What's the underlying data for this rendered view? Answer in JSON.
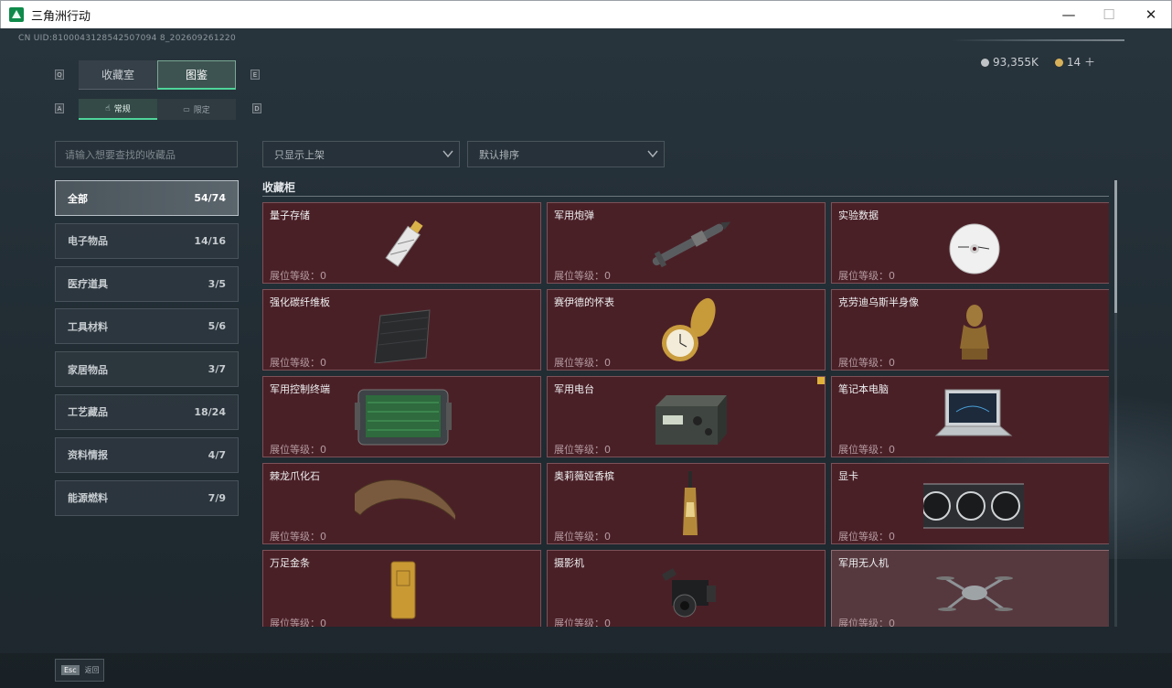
{
  "window": {
    "title": "三角洲行动",
    "controls": {
      "minimize": "—",
      "maximize": "☐",
      "close": "✕"
    }
  },
  "header": {
    "uid": "CN UID:8100043128542507094 8_202609261220",
    "currency": [
      {
        "icon": "silver-coin-icon",
        "value": "93,355K",
        "color": "#c0c4c7"
      },
      {
        "icon": "gold-coin-icon",
        "value": "14 ＋",
        "color": "#d8b15a"
      }
    ]
  },
  "keys": {
    "q": "Q",
    "e": "E",
    "a": "A",
    "d": "D"
  },
  "main_tabs": [
    {
      "label": "收藏室",
      "active": false
    },
    {
      "label": "图鉴",
      "active": true
    }
  ],
  "sub_tabs": [
    {
      "label": "常规",
      "icon": "hand-icon",
      "active": true
    },
    {
      "label": "限定",
      "icon": "card-icon",
      "active": false
    }
  ],
  "search": {
    "placeholder": "请输入想要查找的收藏品"
  },
  "filters": {
    "shelf": "只显示上架",
    "sort": "默认排序"
  },
  "categories": [
    {
      "label": "全部",
      "count": "54/74",
      "active": true
    },
    {
      "label": "电子物品",
      "count": "14/16"
    },
    {
      "label": "医疗道具",
      "count": "3/5"
    },
    {
      "label": "工具材料",
      "count": "5/6"
    },
    {
      "label": "家居物品",
      "count": "3/7"
    },
    {
      "label": "工艺藏品",
      "count": "18/24"
    },
    {
      "label": "资料情报",
      "count": "4/7"
    },
    {
      "label": "能源燃料",
      "count": "7/9"
    }
  ],
  "section_title": "收藏柜",
  "items": [
    {
      "name": "量子存储",
      "level": "展位等级：0",
      "icon": "usb-drive-icon"
    },
    {
      "name": "军用炮弹",
      "level": "展位等级：0",
      "icon": "missile-icon"
    },
    {
      "name": "实验数据",
      "level": "展位等级：0",
      "icon": "disc-icon"
    },
    {
      "name": "强化碳纤维板",
      "level": "展位等级：0",
      "icon": "carbon-plate-icon"
    },
    {
      "name": "赛伊德的怀表",
      "level": "展位等级：0",
      "icon": "pocket-watch-icon"
    },
    {
      "name": "克劳迪乌斯半身像",
      "level": "展位等级：0",
      "icon": "bust-icon"
    },
    {
      "name": "军用控制终端",
      "level": "展位等级：0",
      "icon": "tablet-terminal-icon"
    },
    {
      "name": "军用电台",
      "level": "展位等级：0",
      "icon": "radio-icon",
      "badge": true
    },
    {
      "name": "笔记本电脑",
      "level": "展位等级：0",
      "icon": "laptop-icon"
    },
    {
      "name": "棘龙爪化石",
      "level": "展位等级：0",
      "icon": "claw-fossil-icon"
    },
    {
      "name": "奥莉薇娅香槟",
      "level": "展位等级：0",
      "icon": "champagne-icon"
    },
    {
      "name": "显卡",
      "level": "展位等级：0",
      "icon": "graphics-card-icon"
    },
    {
      "name": "万足金条",
      "level": "展位等级：0",
      "icon": "gold-bar-icon"
    },
    {
      "name": "摄影机",
      "level": "展位等级：0",
      "icon": "camera-icon"
    },
    {
      "name": "军用无人机",
      "level": "展位等级：0",
      "icon": "drone-icon",
      "light": true
    }
  ],
  "footer": {
    "esc_key": "Esc",
    "esc_label": "返回"
  }
}
